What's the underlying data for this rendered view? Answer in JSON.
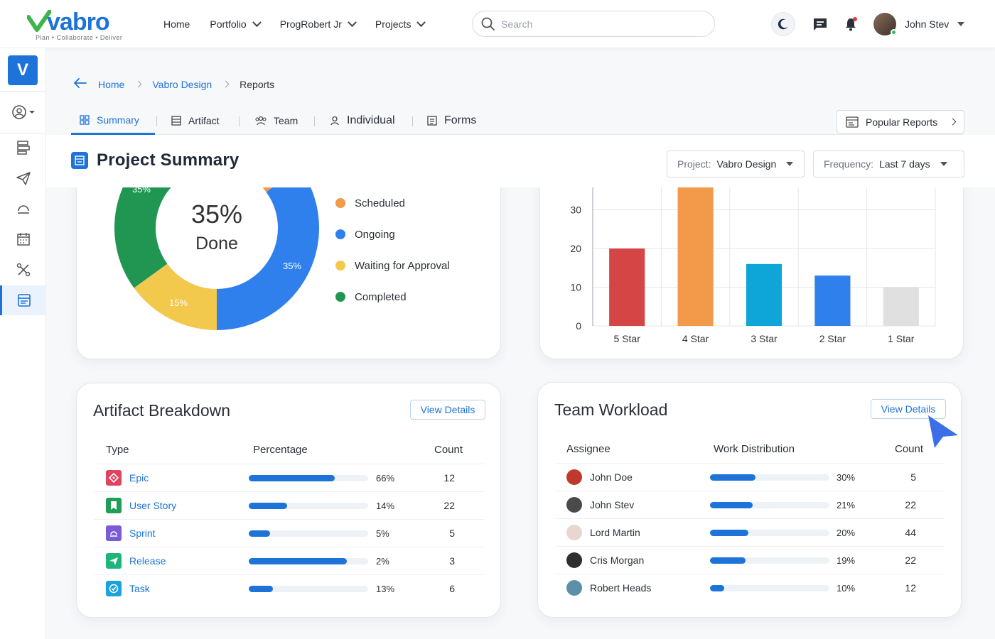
{
  "brand": {
    "name": "vabro",
    "tagline": "Plan • Collaborate • Deliver",
    "badge": "V"
  },
  "nav": [
    {
      "label": "Home",
      "has_menu": false
    },
    {
      "label": "Portfolio",
      "has_menu": true
    },
    {
      "label": "ProgRobert Jr",
      "has_menu": true
    },
    {
      "label": "Projects",
      "has_menu": true
    }
  ],
  "search": {
    "placeholder": "Search"
  },
  "user": {
    "name": "John Stev"
  },
  "breadcrumb": {
    "items": [
      "Home",
      "Vabro Design"
    ],
    "current": "Reports"
  },
  "tabs": [
    {
      "label": "Summary",
      "active": true
    },
    {
      "label": "Artifact"
    },
    {
      "label": "Team"
    },
    {
      "label": "Individual"
    },
    {
      "label": "Forms"
    }
  ],
  "popular_reports": "Popular Reports",
  "page_title": "Project Summary",
  "filters": {
    "project_label": "Project:",
    "project_value": "Vabro Design",
    "frequency_label": "Frequency:",
    "frequency_value": "Last 7 days"
  },
  "status_chart": {
    "center_value": "35%",
    "center_label": "Done",
    "legend": [
      {
        "label": "Scheduled",
        "color": "#f2994a"
      },
      {
        "label": "Ongoing",
        "color": "#2f80ed"
      },
      {
        "label": "Waiting for Approval",
        "color": "#f2c94c"
      },
      {
        "label": "Completed",
        "color": "#219653"
      }
    ]
  },
  "chart_data": [
    {
      "type": "pie",
      "slices": [
        {
          "label": "Scheduled",
          "value": 15,
          "color": "#f2994a"
        },
        {
          "label": "Ongoing",
          "value": 35,
          "data_label": "35%",
          "color": "#2f80ed"
        },
        {
          "label": "Waiting for Approval",
          "value": 15,
          "data_label": "15%",
          "color": "#f2c94c"
        },
        {
          "label": "Completed",
          "value": 35,
          "data_label": "35%",
          "color": "#219653"
        }
      ]
    },
    {
      "type": "bar",
      "categories": [
        "5 Star",
        "4 Star",
        "3 Star",
        "2 Star",
        "1 Star"
      ],
      "values": [
        20,
        37,
        16,
        13,
        10
      ],
      "colors": [
        "#d64545",
        "#f2994a",
        "#0ea5d8",
        "#2f80ed",
        "#e0e0e0"
      ],
      "yticks": [
        0,
        10,
        20,
        30
      ],
      "ylim": [
        0,
        40
      ],
      "grid": true
    }
  ],
  "artifact": {
    "title": "Artifact Breakdown",
    "view_details": "View Details",
    "headers": {
      "type": "Type",
      "percentage": "Percentage",
      "count": "Count"
    },
    "rows": [
      {
        "type": "Epic",
        "percentage": 66,
        "pct_label": "66%",
        "count": "12",
        "icon": "epic-icon",
        "color": "#e0435c"
      },
      {
        "type": "User Story",
        "percentage": 14,
        "pct_label": "14%",
        "count": "22",
        "icon": "user-story-icon",
        "color": "#1e9e56"
      },
      {
        "type": "Sprint",
        "percentage": 5,
        "pct_label": "5%",
        "count": "5",
        "icon": "sprint-icon",
        "color": "#7c5cd6"
      },
      {
        "type": "Release",
        "percentage": 2,
        "pct_label": "2%",
        "count": "3",
        "icon": "release-icon",
        "color": "#1fb57a"
      },
      {
        "type": "Task",
        "percentage": 13,
        "pct_label": "13%",
        "count": "6",
        "icon": "task-icon",
        "color": "#1aa3d9"
      }
    ],
    "bar_fill_fractions": [
      0.72,
      0.32,
      0.18,
      0.82,
      0.2
    ]
  },
  "team": {
    "title": "Team Workload",
    "view_details": "View Details",
    "headers": {
      "assignee": "Assignee",
      "distribution": "Work Distribution",
      "count": "Count"
    },
    "rows": [
      {
        "name": "John Doe",
        "pct_label": "30%",
        "count": "5",
        "fill": 0.38,
        "avatar_color": "#c0392b"
      },
      {
        "name": "John Stev",
        "pct_label": "21%",
        "count": "22",
        "fill": 0.36,
        "avatar_color": "#4a4a4a"
      },
      {
        "name": "Lord Martin",
        "pct_label": "20%",
        "count": "44",
        "fill": 0.32,
        "avatar_color": "#e7d7d0"
      },
      {
        "name": "Cris Morgan",
        "pct_label": "19%",
        "count": "22",
        "fill": 0.3,
        "avatar_color": "#2f2f2f"
      },
      {
        "name": "Robert Heads",
        "pct_label": "10%",
        "count": "12",
        "fill": 0.12,
        "avatar_color": "#5c8fa8"
      }
    ]
  }
}
